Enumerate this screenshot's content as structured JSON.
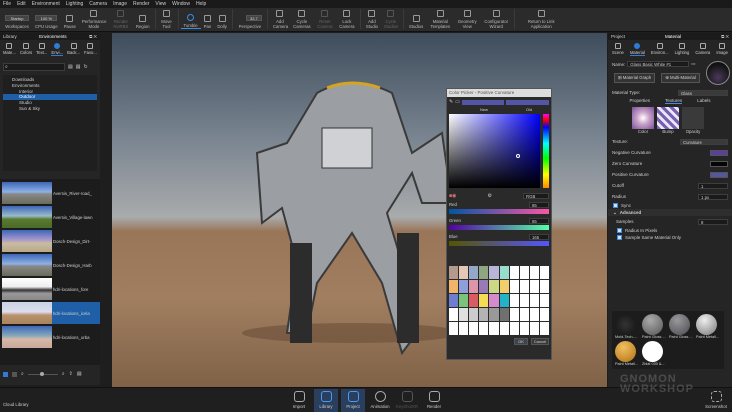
{
  "menu": [
    "File",
    "Edit",
    "Environment",
    "Lighting",
    "Camera",
    "Image",
    "Render",
    "View",
    "Window",
    "Help"
  ],
  "toolbar": {
    "workspace_value": "Startup",
    "cpu_value": "100 %",
    "fov_value": "32,7",
    "buttons": [
      {
        "label": "Workspaces"
      },
      {
        "label": "CPU Usage"
      },
      {
        "label": "Pause"
      },
      {
        "label": "Performance Mode"
      },
      {
        "label": "Render NURBS",
        "disabled": true
      },
      {
        "label": "Region"
      },
      {
        "label": "Move Tool"
      },
      {
        "label": "Tumble",
        "active": true
      },
      {
        "label": "Pan"
      },
      {
        "label": "Dolly"
      },
      {
        "label": "Perspective"
      },
      {
        "label": "Add Camera"
      },
      {
        "label": "Cycle Cameras"
      },
      {
        "label": "Reset Camera",
        "disabled": true
      },
      {
        "label": "Lock Camera"
      },
      {
        "label": "Add Studio"
      },
      {
        "label": "Cycle Studios",
        "disabled": true
      },
      {
        "label": "Studios"
      },
      {
        "label": "Material Templates"
      },
      {
        "label": "Geometry View"
      },
      {
        "label": "Configurator Wizard"
      },
      {
        "label": "Return to Link Application"
      }
    ]
  },
  "left": {
    "tab_library": "Library",
    "title": "Environments",
    "icons": [
      "Mate...",
      "Colors",
      "Text...",
      "Envi...",
      "Back...",
      "Favo..."
    ],
    "tree": [
      "Downloads",
      "Environments",
      "Interior",
      "Outdoor",
      "Studio",
      "Sun & Sky"
    ],
    "thumbs": [
      "Aversis_River-road_",
      "Aversis_Village-lawn",
      "Dosch-Design_Dirt-",
      "Dosch-Design_Harb",
      "hdri-locations_fore",
      "hdri-locations_icela",
      "hdri-locations_urba"
    ],
    "cloud": "Cloud Library"
  },
  "picker": {
    "title": "Color Picker - Positive Curvature",
    "new": "New",
    "old": "Old",
    "mode": "RGB",
    "channels": [
      {
        "label": "Red",
        "value": "85"
      },
      {
        "label": "Green",
        "value": "85"
      },
      {
        "label": "Blue",
        "value": "165"
      }
    ],
    "ok": "OK",
    "cancel": "Cancel",
    "palette": [
      "#b49a8c",
      "#e4c7b6",
      "#96a8c9",
      "#8fa680",
      "#b9b5d9",
      "#98dccd",
      "#f0b46a",
      "#8ea0dc",
      "#dd96a9",
      "#9a7ab5",
      "#cbd985",
      "#f1cd6b",
      "#6f7dd1",
      "#79c47a",
      "#d95b63",
      "#f4dc54",
      "#d58acb",
      "#23b3c9",
      "#ffffff",
      "#e0e0e0",
      "#cccccc",
      "#b3b3b3",
      "#999999",
      "#707070"
    ]
  },
  "right": {
    "tab_project": "Project",
    "title": "Material",
    "icons": [
      "Scene",
      "Material",
      "Environ...",
      "Lighting",
      "Camera",
      "Image"
    ],
    "name_label": "Name:",
    "name_value": "Glass Basic White #1",
    "graph": "Material Graph",
    "multi": "Multi-Material",
    "type_label": "Material Type:",
    "type_value": "Glass",
    "subtabs": [
      "Properties",
      "Textures",
      "Labels"
    ],
    "slots": [
      "Color",
      "Bump",
      "Opacity"
    ],
    "texture_label": "Texture:",
    "texture_value": "Curvature",
    "neg": "Negative Curvature",
    "zero": "Zero Curvature",
    "pos": "Positive Curvature",
    "colors": {
      "neg": "#5a3fa0",
      "zero": "#050505",
      "pos": "#5555a5"
    },
    "cutoff_label": "Cutoff",
    "cutoff_value": "1",
    "radius_label": "Radius",
    "radius_value": "1 px",
    "sync": "Sync",
    "advanced": "Advanced",
    "samples_label": "Samples",
    "samples_value": "8",
    "radius_pixels": "Radius In Pixels",
    "same_material": "Sample Same Material Only",
    "library": [
      "Mold-Tech-...",
      "Paint Gloss ...",
      "Paint Gloss ...",
      "Paint Metall...",
      "Paint Metall...",
      "Zblat 030 &..."
    ],
    "screenshot": "Screenshot"
  },
  "bottom": [
    "Import",
    "Library",
    "Project",
    "Animation",
    "KeyShotXR",
    "Render"
  ],
  "watermark": "GNOMON WORKSHOP"
}
